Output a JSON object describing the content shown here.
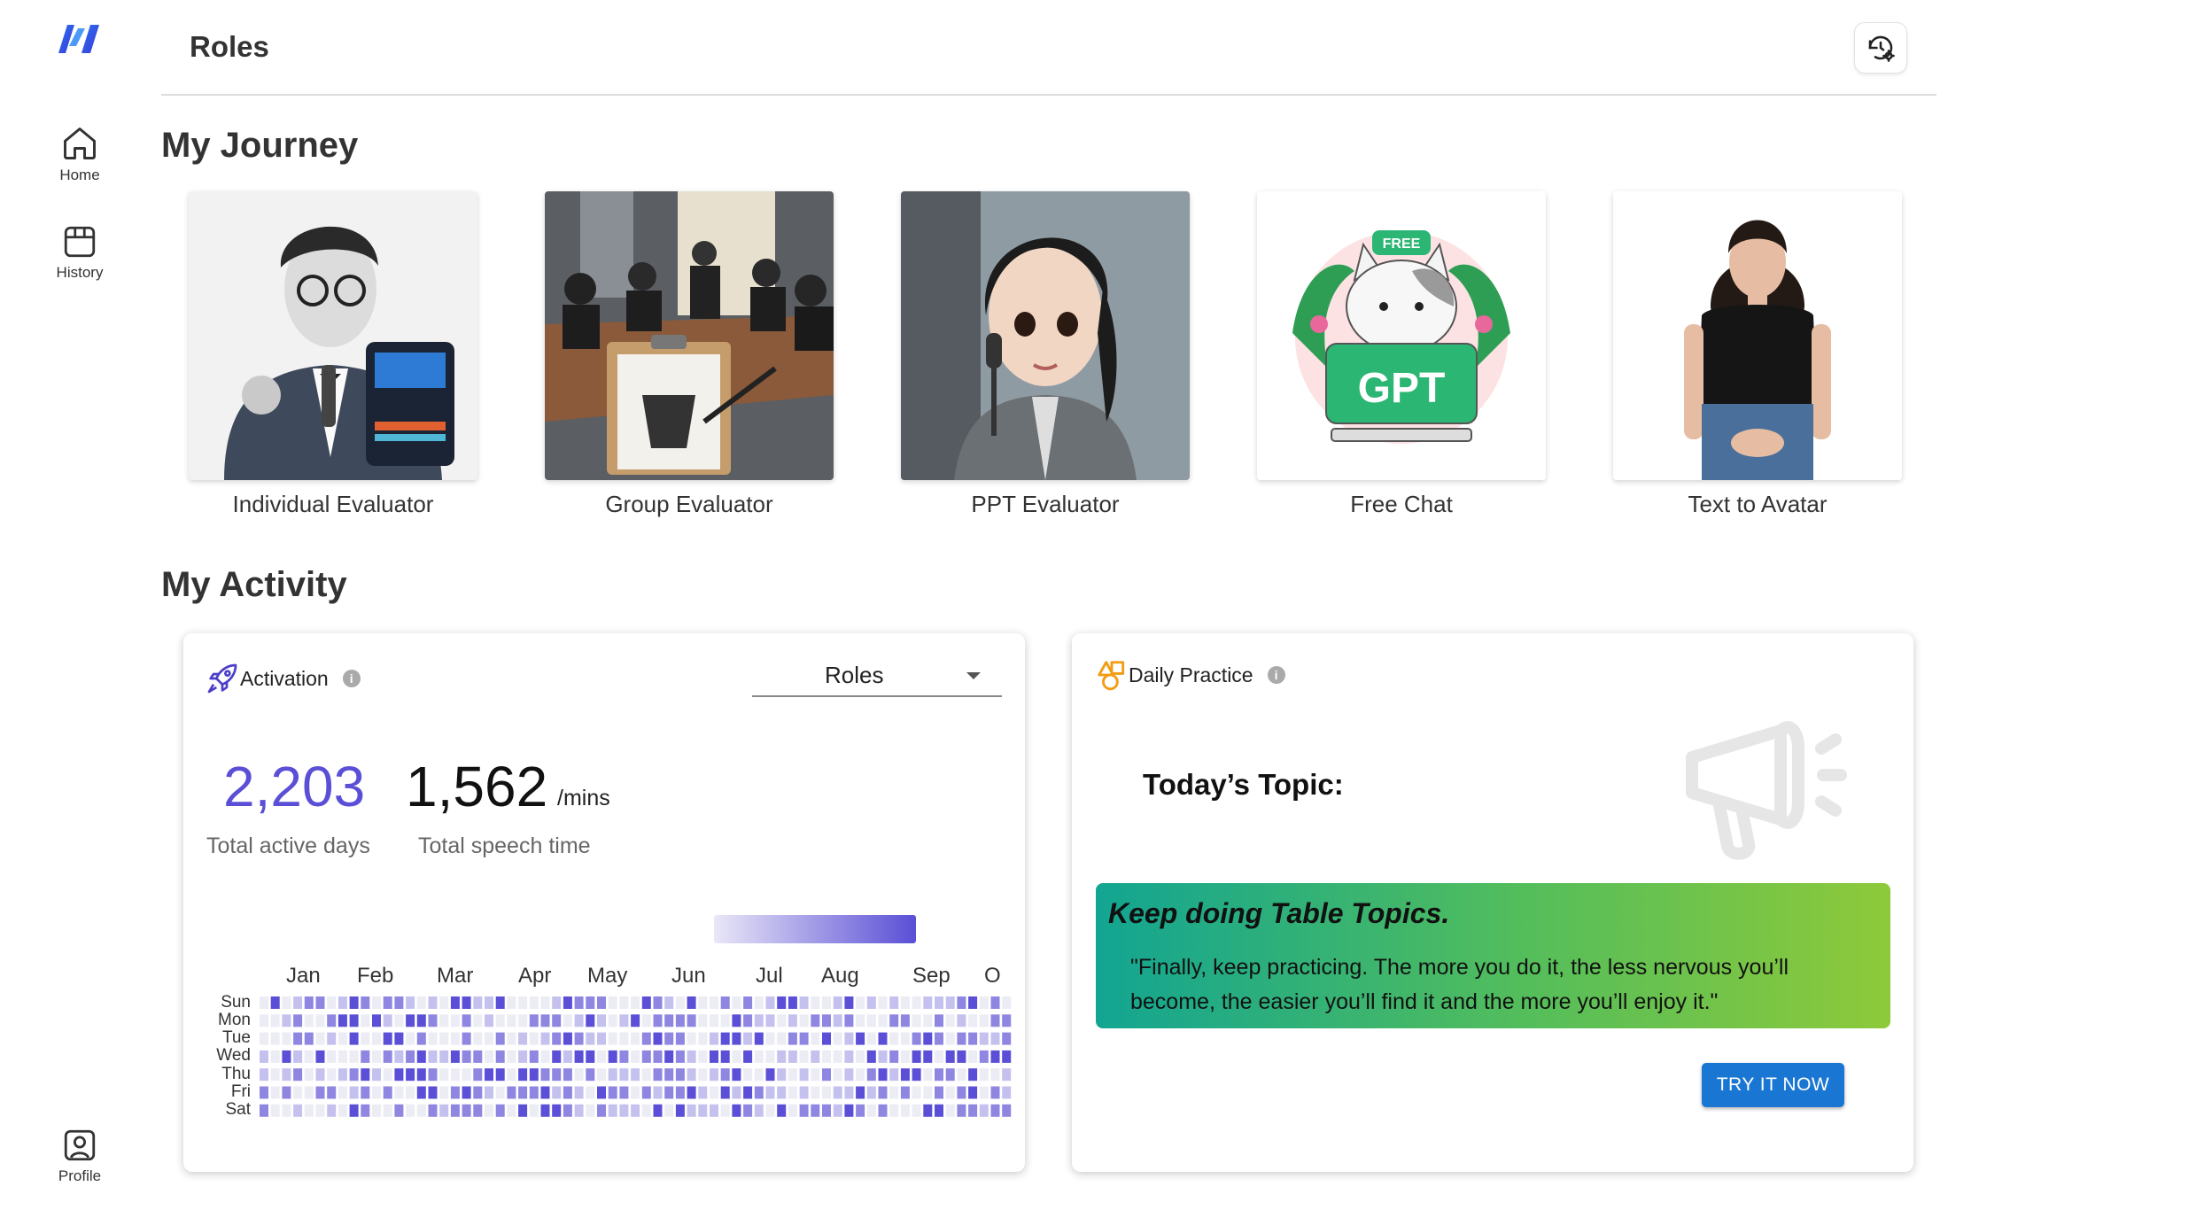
{
  "sidebar": {
    "logo": "app-logo",
    "items": [
      {
        "label": "Home",
        "icon": "home-icon"
      },
      {
        "label": "History",
        "icon": "history-icon"
      }
    ],
    "profile": {
      "label": "Profile",
      "icon": "profile-icon"
    }
  },
  "header": {
    "title": "Roles",
    "settings_icon": "history-settings-icon"
  },
  "journey": {
    "title": "My Journey",
    "roles": [
      {
        "label": "Individual Evaluator"
      },
      {
        "label": "Group Evaluator"
      },
      {
        "label": "PPT Evaluator"
      },
      {
        "label": "Free Chat",
        "badge": "FREE",
        "logo_text": "GPT"
      },
      {
        "label": "Text to Avatar"
      }
    ]
  },
  "activity_section": {
    "title": "My Activity"
  },
  "activation": {
    "title": "Activation",
    "info": "i",
    "select_value": "Roles",
    "active_days": "2,203",
    "active_days_label": "Total active days",
    "speech_time": "1,562",
    "speech_unit": "/mins",
    "speech_label": "Total speech time",
    "accent_color": "#5a4fd6",
    "months": [
      "Jan",
      "Feb",
      "Mar",
      "Apr",
      "May",
      "Jun",
      "Jul",
      "Aug",
      "Sep",
      "O"
    ],
    "days": [
      "Sun",
      "Mon",
      "Tue",
      "Wed",
      "Thu",
      "Fri",
      "Sat"
    ],
    "heatmap_levels": [
      "0301220132022101033113000013222000321030020201331001301010011123020",
      "0012002330310332002010002220131013022220003211010221200022002010022",
      "0002201030033020002002010123211000232200133130022030130300232022112",
      "1031030002021231132202012031330320223210330300110100103120330330233",
      "1012010123103332000233033222020111022210123003101020102313302203001",
      "2020022012020033023210222312103220212231031321101001131202002023021",
      "2001001032002002122202030332102111030311103210302221320200033022122"
    ]
  },
  "daily_practice": {
    "title": "Daily Practice",
    "info": "i",
    "topic_title": "Today’s Topic:",
    "quote_title": "Keep doing Table Topics.",
    "quote_text": "\"Finally, keep practicing. The more you do it, the less nervous you’ll become, the easier you’ll find it and the more you’ll enjoy it.\"",
    "button_label": "TRY IT NOW"
  }
}
